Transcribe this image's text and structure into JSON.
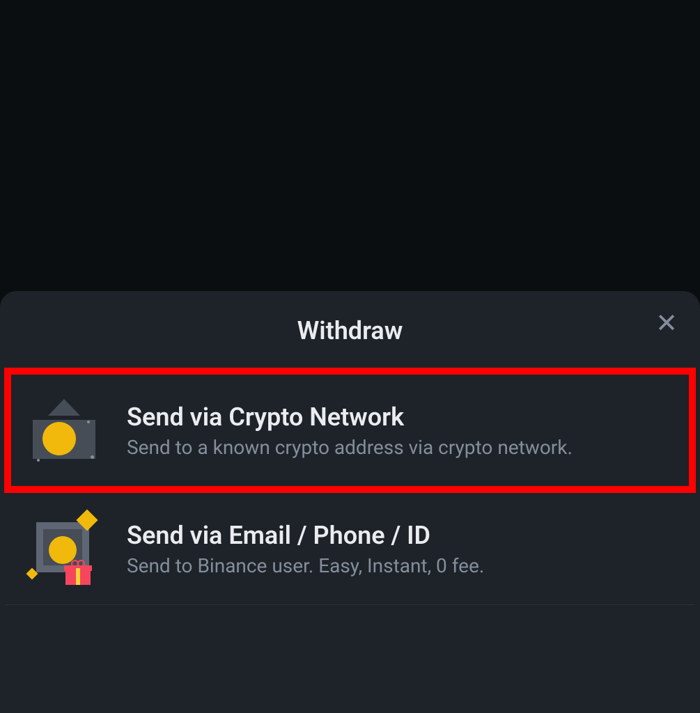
{
  "sheet": {
    "title": "Withdraw",
    "options": [
      {
        "title": "Send via Crypto Network",
        "description": "Send to a known crypto address via crypto network.",
        "highlighted": true
      },
      {
        "title": "Send via Email / Phone / ID",
        "description": "Send to Binance user. Easy, Instant, 0 fee.",
        "highlighted": false
      }
    ]
  }
}
